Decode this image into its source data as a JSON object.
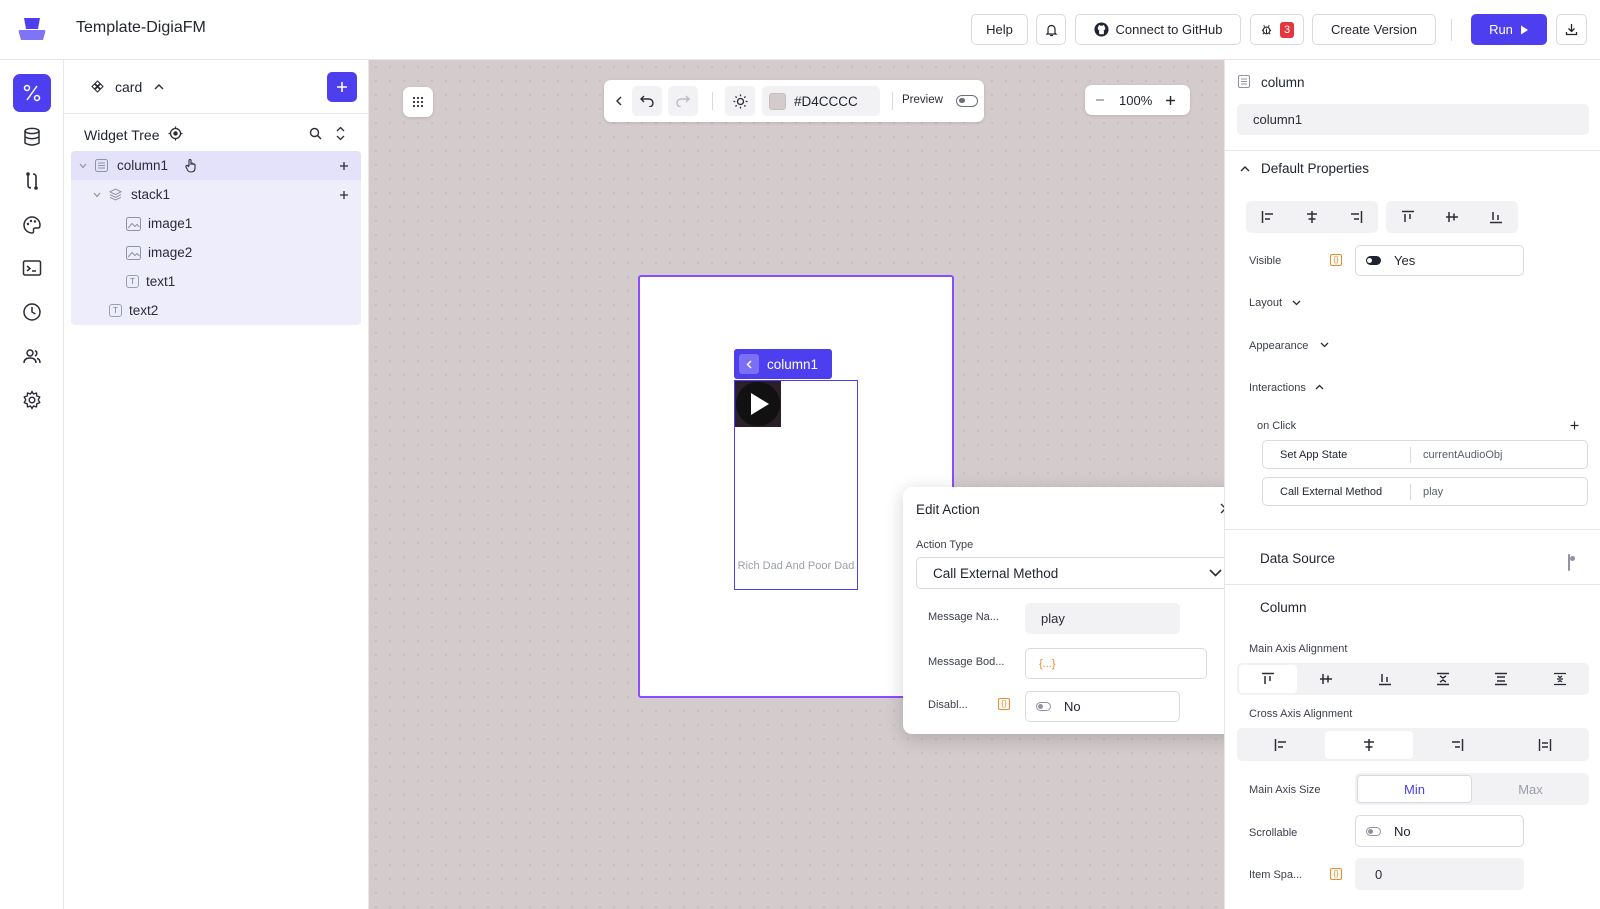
{
  "app": {
    "title": "Template-DigiaFM"
  },
  "topbar": {
    "help_label": "Help",
    "github_label": "Connect to GitHub",
    "bug_count": "3",
    "create_version_label": "Create Version",
    "run_label": "Run"
  },
  "tree": {
    "component_name": "card",
    "section_title": "Widget Tree",
    "items": [
      {
        "label": "column1",
        "type": "column"
      },
      {
        "label": "stack1",
        "type": "stack"
      },
      {
        "label": "image1",
        "type": "image"
      },
      {
        "label": "image2",
        "type": "image"
      },
      {
        "label": "text1",
        "type": "text"
      },
      {
        "label": "text2",
        "type": "text"
      }
    ]
  },
  "canvas": {
    "color_value": "#D4CCCC",
    "preview_label": "Preview",
    "zoom": "100%",
    "selected_chip": "column1",
    "card_caption": "Rich Dad And Poor Dad"
  },
  "modal": {
    "title": "Edit Action",
    "action_type_label": "Action Type",
    "action_type_value": "Call External Method",
    "message_name_label": "Message Na...",
    "message_name_value": "play",
    "message_body_label": "Message Bod...",
    "message_body_value": "{...}",
    "disable_label": "Disabl...",
    "disable_value": "No"
  },
  "right_panel": {
    "widget_type": "column",
    "widget_name": "column1",
    "default_properties_label": "Default Properties",
    "visible_label": "Visible",
    "visible_value": "Yes",
    "layout_label": "Layout",
    "appearance_label": "Appearance",
    "interactions_label": "Interactions",
    "on_click_label": "on Click",
    "actions": [
      {
        "name": "Set App State",
        "value": "currentAudioObj"
      },
      {
        "name": "Call External Method",
        "value": "play"
      }
    ],
    "data_source_label": "Data Source",
    "column_section_label": "Column",
    "main_axis_alignment_label": "Main Axis Alignment",
    "cross_axis_alignment_label": "Cross Axis Alignment",
    "main_axis_size_label": "Main Axis Size",
    "main_axis_size_options": [
      "Min",
      "Max"
    ],
    "scrollable_label": "Scrollable",
    "scrollable_value": "No",
    "item_spacing_label": "Item Spa...",
    "item_spacing_value": "0"
  },
  "colors": {
    "accent": "#4d3ff0",
    "canvas_bg": "#D4CCCC",
    "selection_outline": "#8b4dff",
    "badge": "#e5353f",
    "code_orange": "#f08a2b"
  }
}
